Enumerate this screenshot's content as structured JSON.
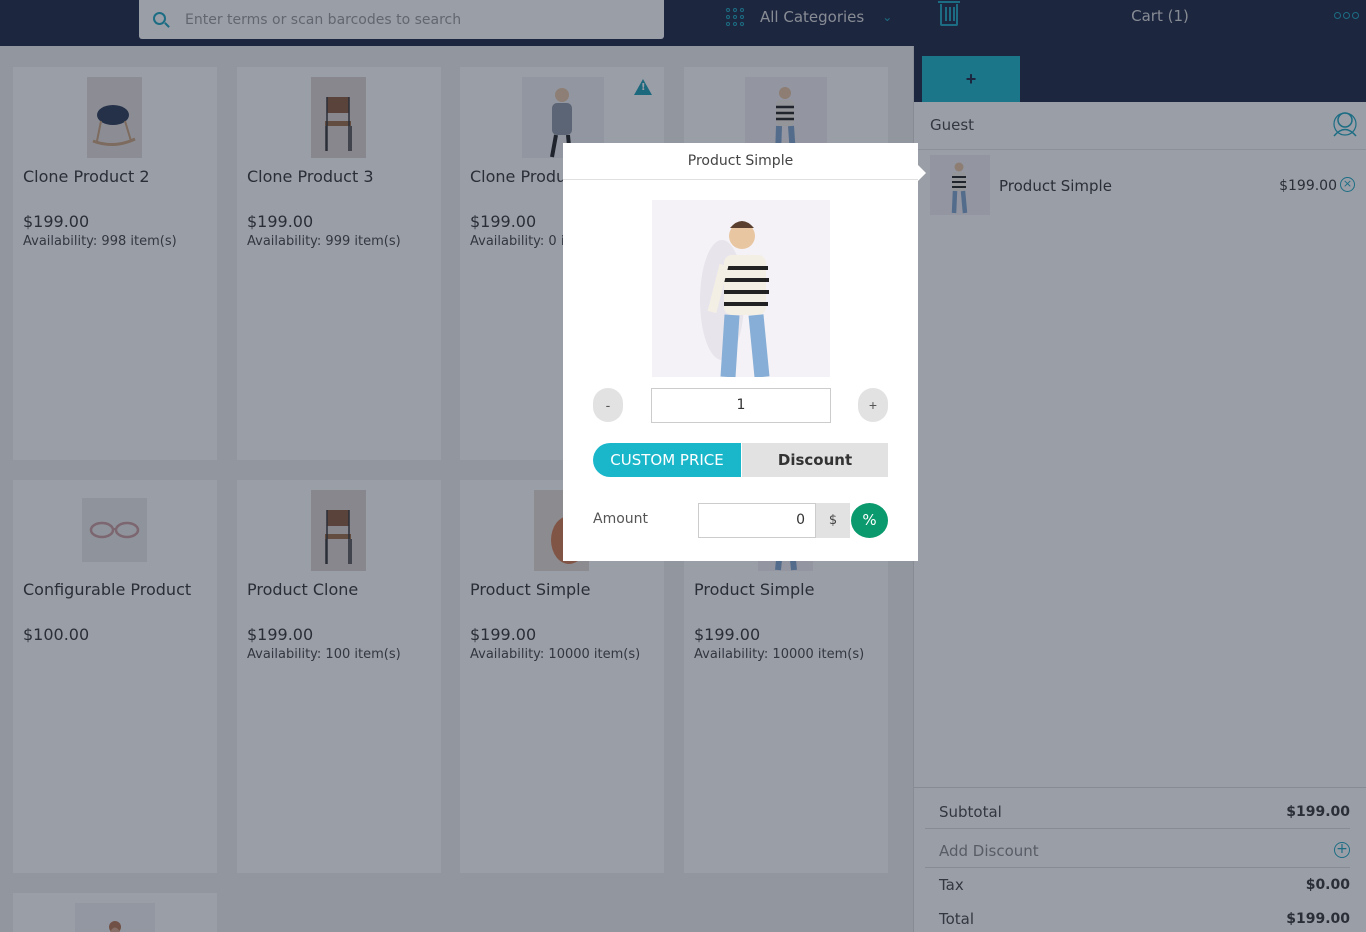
{
  "topbar": {
    "search_placeholder": "Enter terms or scan barcodes to search",
    "category": "All Categories",
    "cart_title": "Cart (1)"
  },
  "products": [
    {
      "name": "Clone Product 2",
      "price": "$199.00",
      "availability": "Availability: 998 item(s)"
    },
    {
      "name": "Clone Product 3",
      "price": "$199.00",
      "availability": "Availability: 999 item(s)"
    },
    {
      "name": "Clone Produ",
      "price": "$199.00",
      "availability": "Availability: 0 i"
    },
    {
      "name": "",
      "price": "",
      "availability": ""
    },
    {
      "name": "Configurable Product",
      "price": "$100.00",
      "availability": ""
    },
    {
      "name": "Product Clone",
      "price": "$199.00",
      "availability": "Availability: 100 item(s)"
    },
    {
      "name": "Product Simple",
      "price": "$199.00",
      "availability": "Availability: 10000 item(s)"
    },
    {
      "name": "Product Simple",
      "price": "$199.00",
      "availability": "Availability: 10000 item(s)"
    }
  ],
  "cart": {
    "add_label": "+",
    "customer": "Guest",
    "items": [
      {
        "name": "Product Simple",
        "price": "$199.00"
      }
    ],
    "subtotal_label": "Subtotal",
    "subtotal": "$199.00",
    "add_discount_label": "Add Discount",
    "tax_label": "Tax",
    "tax": "$0.00",
    "total_label": "Total",
    "total": "$199.00"
  },
  "popup": {
    "title": "Product Simple",
    "minus": "-",
    "plus": "+",
    "qty": "1",
    "custom_price_label": "CUSTOM PRICE",
    "discount_label": "Discount",
    "amount_label": "Amount",
    "amount_value": "0",
    "dollar": "$",
    "percent": "%"
  },
  "colors": {
    "navy": "#1c2542",
    "accent": "#1ab7cb",
    "green": "#0a9a6d"
  }
}
